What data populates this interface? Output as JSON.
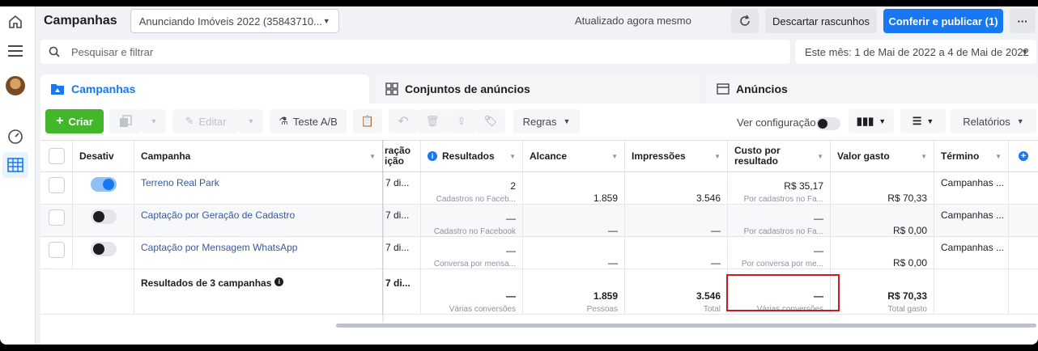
{
  "topbar": {
    "title": "Campanhas",
    "account": "Anunciando Imóveis 2022 (35843710...",
    "updated": "Atualizado agora mesmo",
    "discard": "Descartar rascunhos",
    "publish": "Conferir e publicar (1)",
    "more": "···"
  },
  "search": {
    "placeholder": "Pesquisar e filtrar"
  },
  "daterange": "Este mês: 1 de Mai de 2022 a 4 de Mai de 2022",
  "tabs": [
    {
      "label": "Campanhas"
    },
    {
      "label": "Conjuntos de anúncios"
    },
    {
      "label": "Anúncios"
    }
  ],
  "toolbar": {
    "create": "Criar",
    "edit": "Editar",
    "abtest": "Teste A/B",
    "rules": "Regras",
    "view_config": "Ver configuração",
    "reports": "Relatórios"
  },
  "columns": {
    "toggle": "Desativ",
    "campaign": "Campanha",
    "delivery": "ração ição",
    "results": "Resultados",
    "reach": "Alcance",
    "impressions": "Impressões",
    "cost_per_result": "Custo por resultado",
    "spent": "Valor gasto",
    "end": "Término"
  },
  "rows": [
    {
      "on": true,
      "name": "Terreno Real Park",
      "delivery": "7 di...",
      "results": "2",
      "results_sub": "Cadastros no Faceb...",
      "reach": "1.859",
      "impressions": "3.546",
      "cpr": "R$ 35,17",
      "cpr_sub": "Por cadastros no Fa...",
      "spent": "R$ 70,33",
      "end": "Campanhas ..."
    },
    {
      "on": false,
      "name": "Captação por Geração de Cadastro",
      "delivery": "7 di...",
      "results": "—",
      "results_sub": "Cadastro no Facebook",
      "reach": "—",
      "impressions": "—",
      "cpr": "—",
      "cpr_sub": "Por cadastros no Fa...",
      "spent": "R$ 0,00",
      "end": "Campanhas ..."
    },
    {
      "on": false,
      "name": "Captação por Mensagem WhatsApp",
      "delivery": "7 di...",
      "results": "—",
      "results_sub": "Conversa por mensa...",
      "reach": "—",
      "impressions": "—",
      "cpr": "—",
      "cpr_sub": "Por conversa por me...",
      "spent": "R$ 0,00",
      "end": "Campanhas ..."
    }
  ],
  "totals": {
    "label": "Resultados de 3 campanhas",
    "delivery": "7 di...",
    "results": "—",
    "results_sub": "Várias conversões",
    "reach": "1.859",
    "reach_sub": "Pessoas",
    "impressions": "3.546",
    "impressions_sub": "Total",
    "cpr": "—",
    "cpr_sub": "Várias conversões",
    "spent": "R$ 70,33",
    "spent_sub": "Total gasto"
  },
  "colors": {
    "accent": "#1877f2",
    "create": "#42b72a",
    "highlight": "#c91b25"
  }
}
